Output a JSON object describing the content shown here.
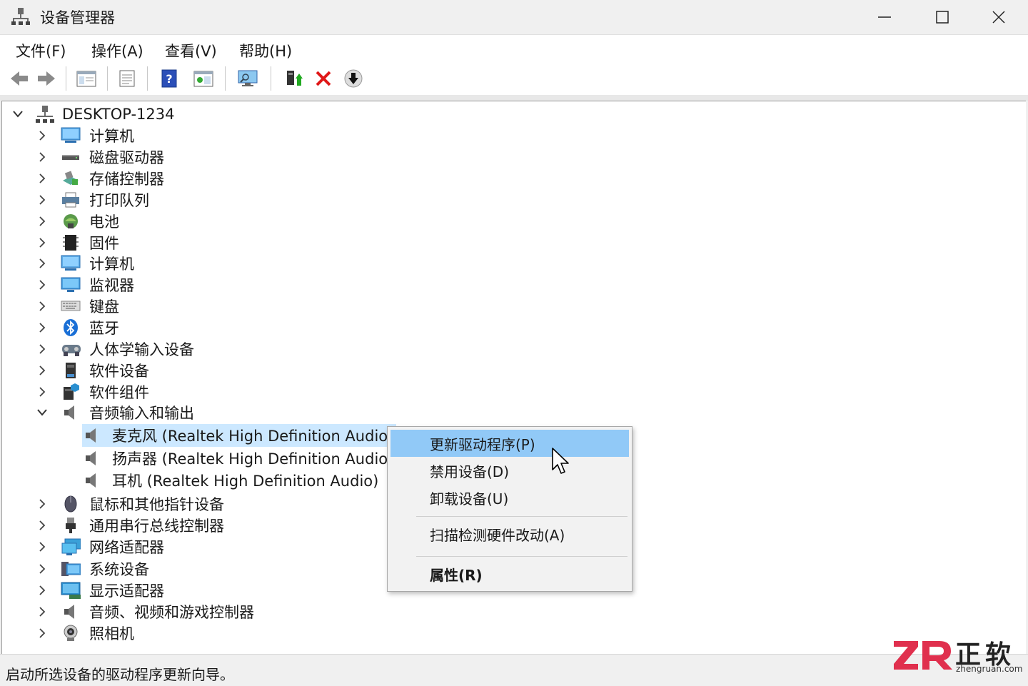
{
  "window": {
    "title": "设备管理器"
  },
  "menu": [
    "文件(F)",
    "操作(A)",
    "查看(V)",
    "帮助(H)"
  ],
  "tree": {
    "root": "DESKTOP-1234",
    "items": [
      "计算机",
      "磁盘驱动器",
      "存储控制器",
      "打印队列",
      "电池",
      "固件",
      "计算机",
      "监视器",
      "键盘",
      "蓝牙",
      "人体学输入设备",
      "软件设备",
      "软件组件"
    ],
    "audio": {
      "label": "音频输入和输出",
      "children": [
        "麦克风 (Realtek High Definition Audio)",
        "扬声器 (Realtek High Definition Audio)",
        "耳机 (Realtek High Definition Audio)"
      ]
    },
    "after": [
      "鼠标和其他指针设备",
      "通用串行总线控制器",
      "网络适配器",
      "系统设备",
      "显示适配器",
      "音频、视频和游戏控制器",
      "照相机"
    ]
  },
  "context_menu": {
    "update_driver": "更新驱动程序(P)",
    "disable": "禁用设备(D)",
    "uninstall": "卸载设备(U)",
    "scan": "扫描检测硬件改动(A)",
    "properties": "属性(R)"
  },
  "status": "启动所选设备的驱动程序更新向导。",
  "watermark": {
    "cn": "正软",
    "en": "zhengruan.com"
  },
  "colors": {
    "selection": "#cce8ff",
    "menu_highlight": "#91c9f7",
    "accent": "#e0304e"
  }
}
